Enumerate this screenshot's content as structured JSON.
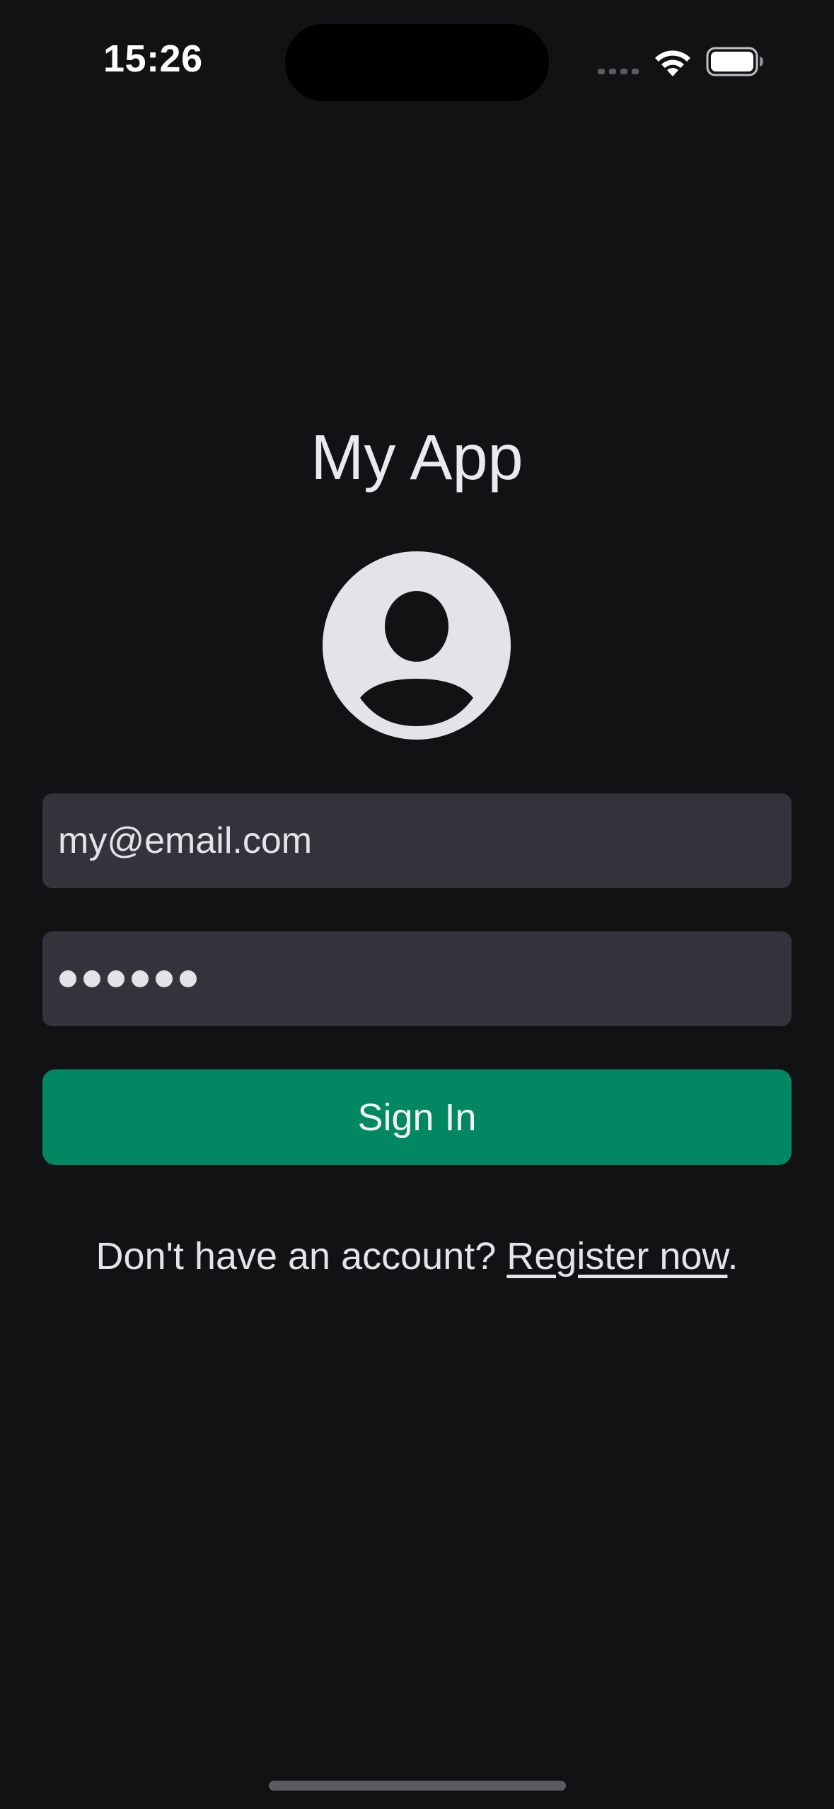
{
  "status_bar": {
    "time": "15:26",
    "signal_icon": "cellular-dots-icon",
    "wifi_icon": "wifi-icon",
    "battery_icon": "battery-icon"
  },
  "app": {
    "title": "My App",
    "avatar_icon": "person-circle-icon"
  },
  "login_form": {
    "email_value": "my@email.com",
    "password_masked_length": 6,
    "sign_in_label": "Sign In"
  },
  "register": {
    "prompt": "Don't have an account? ",
    "link_label": "Register now",
    "suffix": "."
  },
  "colors": {
    "background": "#121214",
    "field_background": "#34333b",
    "accent": "#018862",
    "text": "#e4e4e8"
  }
}
